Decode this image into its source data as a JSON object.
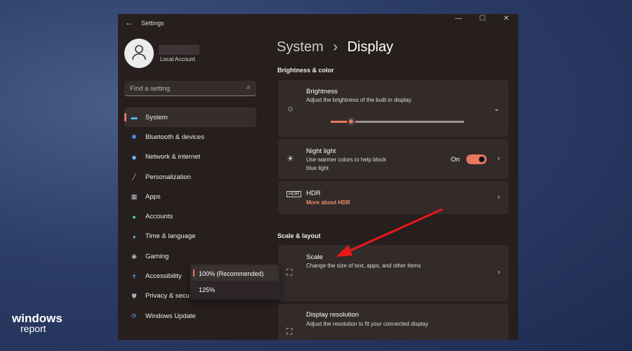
{
  "window": {
    "title": "Settings",
    "back": "←",
    "minimize": "—",
    "maximize": "☐",
    "close": "✕"
  },
  "account": {
    "name": "Local Account"
  },
  "search": {
    "placeholder": "Find a setting"
  },
  "nav": [
    {
      "label": "System",
      "icon": "monitor-icon",
      "color": "#4cc2ff"
    },
    {
      "label": "Bluetooth & devices",
      "icon": "bluetooth-icon",
      "color": "#4ea3ff"
    },
    {
      "label": "Network & internet",
      "icon": "wifi-icon",
      "color": "#6ab7ff"
    },
    {
      "label": "Personalization",
      "icon": "brush-icon",
      "color": "#e8a070"
    },
    {
      "label": "Apps",
      "icon": "apps-icon",
      "color": "#b9c3d0"
    },
    {
      "label": "Accounts",
      "icon": "person-icon",
      "color": "#4fd6a0"
    },
    {
      "label": "Time & language",
      "icon": "globe-icon",
      "color": "#5fb8f0"
    },
    {
      "label": "Gaming",
      "icon": "gamepad-icon",
      "color": "#bbbbbb"
    },
    {
      "label": "Accessibility",
      "icon": "accessibility-icon",
      "color": "#4ea3ff"
    },
    {
      "label": "Privacy & security",
      "icon": "shield-icon",
      "color": "#aab0bb"
    },
    {
      "label": "Windows Update",
      "icon": "update-icon",
      "color": "#4ea3ff"
    }
  ],
  "breadcrumb": {
    "parent": "System",
    "sep": "›",
    "current": "Display"
  },
  "sections": {
    "brightness": "Brightness & color",
    "scale": "Scale & layout"
  },
  "brightness": {
    "title": "Brightness",
    "desc": "Adjust the brightness of the built-in display",
    "value_percent": 15
  },
  "night_light": {
    "title": "Night light",
    "desc1": "Use warmer colors to help block",
    "desc2": "blue light",
    "state": "On"
  },
  "hdr": {
    "title": "HDR",
    "link": "More about HDR"
  },
  "scale": {
    "title": "Scale",
    "desc": "Change the size of text, apps, and other items",
    "options": [
      "100% (Recommended)",
      "125%"
    ]
  },
  "resolution": {
    "title": "Display resolution",
    "desc": "Adjust the resolution to fit your connected display"
  },
  "watermark": {
    "line1": "windows",
    "line2": "report"
  },
  "accent": "#e8785d"
}
